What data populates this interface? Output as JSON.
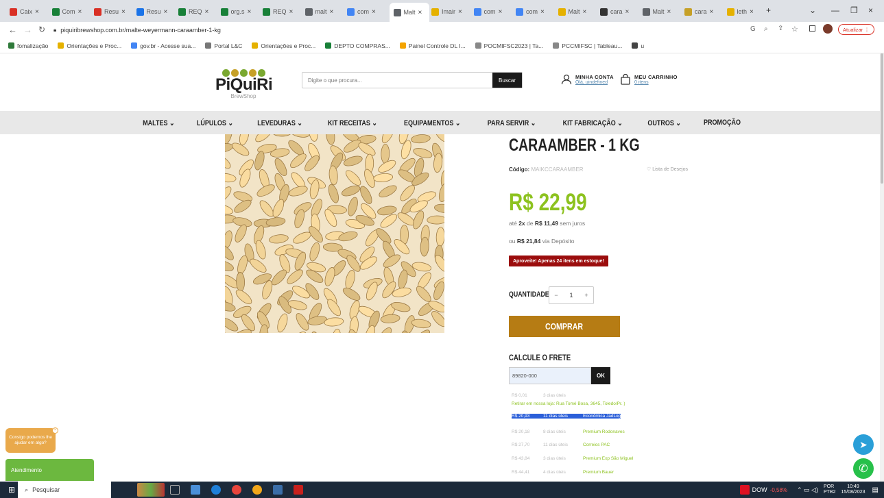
{
  "browser": {
    "tabs": [
      {
        "label": "Caix",
        "color": "#d93025"
      },
      {
        "label": "Com",
        "color": "#188038"
      },
      {
        "label": "Resu",
        "color": "#d93025"
      },
      {
        "label": "Resu",
        "color": "#1a73e8"
      },
      {
        "label": "REQ",
        "color": "#188038"
      },
      {
        "label": "org.s",
        "color": "#188038"
      },
      {
        "label": "REQ",
        "color": "#188038"
      },
      {
        "label": "malt",
        "color": "#5f6368"
      },
      {
        "label": "com",
        "color": "#4285f4"
      },
      {
        "label": "Malt",
        "color": "#5f6368"
      },
      {
        "label": "Imair",
        "color": "#e5b100"
      },
      {
        "label": "com",
        "color": "#4285f4"
      },
      {
        "label": "com",
        "color": "#4285f4"
      },
      {
        "label": "Malt",
        "color": "#e5b100"
      },
      {
        "label": "cara",
        "color": "#333333"
      },
      {
        "label": "Malt",
        "color": "#5f6368"
      },
      {
        "label": "cara",
        "color": "#c6a027"
      },
      {
        "label": "leth",
        "color": "#e5b100"
      }
    ],
    "url": "piquiribrewshop.com.br/malte-weyermann-caraamber-1-kg",
    "update_label": "Atualizar",
    "bookmarks": [
      "fomalização",
      "Orientações e Proc...",
      "gov.br - Acesse sua...",
      "Portal L&C",
      "Orientações e Proc...",
      "DEPTO COMPRAS...",
      "Painel Controle DL I...",
      "POCMIFSC2023 | Ta...",
      "PCCMIFSC | Tableau...",
      "u"
    ]
  },
  "header": {
    "logo_name": "PiQuiRi",
    "logo_sub": "BrewShop",
    "search_placeholder": "Digite o que procura...",
    "search_button": "Buscar",
    "account_title": "MINHA CONTA",
    "account_sub": "Olá, uindefined",
    "cart_title": "MEU CARRINHO",
    "cart_sub": "0 itens"
  },
  "nav": [
    "MALTES ⌄",
    "LÚPULOS ⌄",
    "LEVEDURAS ⌄",
    "KIT RECEITAS ⌄",
    "EQUIPAMENTOS ⌄",
    "PARA SERVIR ⌄",
    "KIT FABRICAÇÃO ⌄",
    "OUTROS ⌄",
    "PROMOÇÃO"
  ],
  "product": {
    "title": "CARAAMBER - 1 KG",
    "code_label": "Código:",
    "code_value": "MAIKCCARAAMBER",
    "wishlist": "♡ Lista de Desejos",
    "price": "R$ 22,99",
    "inst_pre": "até",
    "inst_n": "2x",
    "inst_mid": "de",
    "inst_val": "R$ 11,49",
    "inst_post": "sem juros",
    "dep_pre": "ou",
    "dep_val": "R$ 21,84",
    "dep_post": "via Depósito",
    "stock": "Aproveite! Apenas 24 itens em estoque!",
    "qty_label": "QUANTIDADE",
    "qty_value": "1",
    "buy": "COMPRAR",
    "frete_label": "CALCULE O FRETE",
    "cep": "89820-000",
    "ok": "OK",
    "shipping": [
      {
        "price": "R$ 0,01",
        "days": "3 dias úteis",
        "name": ""
      },
      {
        "price": "",
        "days": "",
        "name": "Retirar em nossa loja: Rua Tomé Bosa, 3645, Toledo/Pr. )"
      },
      {
        "price": "R$ 20,93",
        "days": "11 dias úteis",
        "name": "Econômica JadLog"
      },
      {
        "price": "R$ 20,18",
        "days": "8 dias úteis",
        "name": "Premium Rodonaves"
      },
      {
        "price": "R$ 27,70",
        "days": "11 dias úteis",
        "name": "Correios PAC"
      },
      {
        "price": "R$ 43,84",
        "days": "3 dias úteis",
        "name": "Premium Exp São Miguel"
      },
      {
        "price": "R$ 44,41",
        "days": "4 dias úteis",
        "name": "Premium Bauer"
      }
    ]
  },
  "widgets": {
    "chat_bubble": "Consigo podemos lhe ajudar em algo?",
    "atendimento": "Atendimento"
  },
  "taskbar": {
    "search": "Pesquisar",
    "dow_label": "DOW",
    "dow_change": "-0,58%",
    "lang1": "POR",
    "lang2": "PTB2",
    "time": "10:49",
    "date": "15/08/2023"
  }
}
